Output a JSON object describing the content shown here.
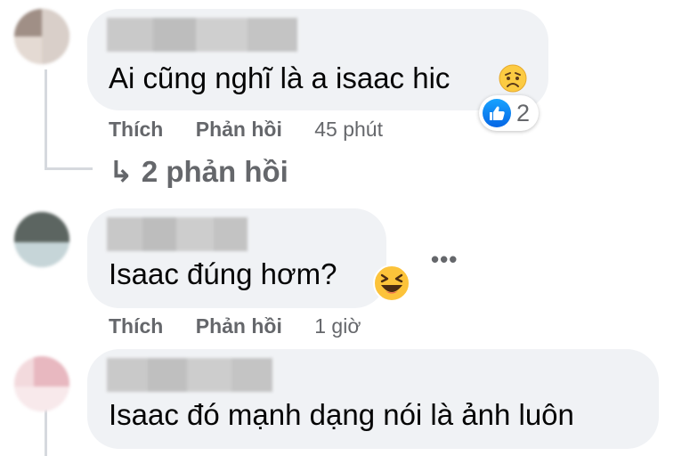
{
  "comments": [
    {
      "text": "Ai cũng nghĩ là a isaac hic",
      "emoji": "worried-face",
      "actions": {
        "like": "Thích",
        "reply": "Phản hồi",
        "time": "45 phút"
      },
      "reaction": {
        "type": "like",
        "count": "2"
      },
      "replies_link": "↳ 2 phản hồi"
    },
    {
      "text": "Isaac đúng hơm?",
      "emoji": "laughing-face",
      "actions": {
        "like": "Thích",
        "reply": "Phản hồi",
        "time": "1 giờ"
      },
      "more": "•••"
    },
    {
      "text": "Isaac đó mạnh dạng nói là ảnh luôn"
    }
  ],
  "colors": {
    "bubble": "#f0f2f5",
    "meta_text": "#65676b",
    "thread_line": "#d6d9de",
    "like_blue": "#0866ff"
  }
}
